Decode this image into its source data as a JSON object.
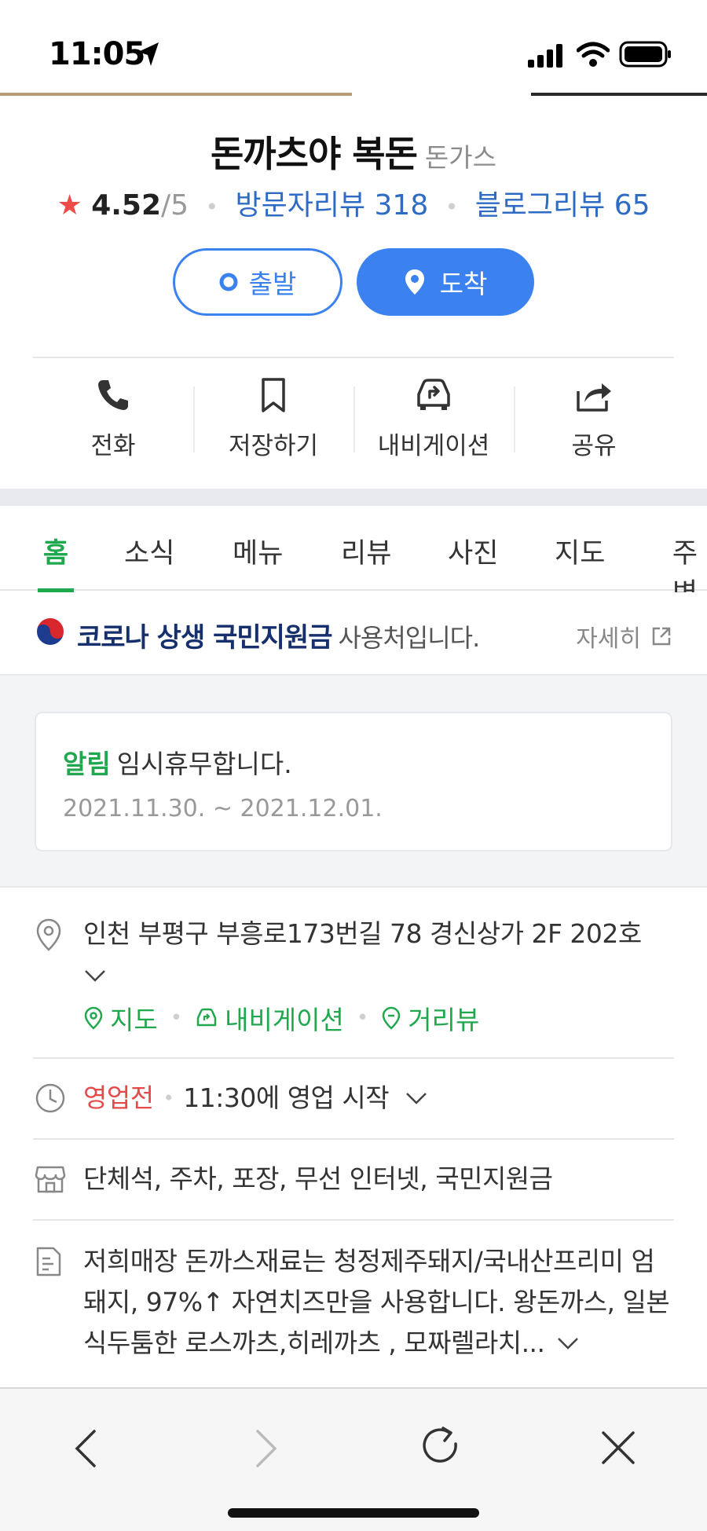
{
  "status_bar": {
    "time": "11:05"
  },
  "place": {
    "name": "돈까츠야 복돈",
    "category": "돈가스",
    "rating": "4.52",
    "rating_max": "/5",
    "visitor_reviews": "방문자리뷰 318",
    "blog_reviews": "블로그리뷰 65"
  },
  "route_buttons": {
    "start": "출발",
    "arrive": "도착"
  },
  "actions": [
    {
      "label": "전화",
      "icon": "phone-icon"
    },
    {
      "label": "저장하기",
      "icon": "bookmark-icon"
    },
    {
      "label": "내비게이션",
      "icon": "car-navigation-icon"
    },
    {
      "label": "공유",
      "icon": "share-icon"
    }
  ],
  "tabs": [
    "홈",
    "소식",
    "메뉴",
    "리뷰",
    "사진",
    "지도",
    "주변"
  ],
  "active_tab": "홈",
  "covid_banner": {
    "highlight": "코로나 상생 국민지원금",
    "suffix": "사용처입니다.",
    "more": "자세히"
  },
  "notice": {
    "tag": "알림",
    "text": "임시휴무합니다.",
    "date": "2021.11.30. ~ 2021.12.01."
  },
  "info": {
    "address": "인천 부평구 부흥로173번길 78 경신상가 2F 202호",
    "address_links": [
      "지도",
      "내비게이션",
      "거리뷰"
    ],
    "status": "영업전",
    "hours": "11:30에 영업 시작",
    "amenities": "단체석, 주차, 포장, 무선 인터넷, 국민지원금",
    "description_lines": [
      "저희매장 돈까스재료는 청정제주돼지/국내산프리미 엄",
      "돼지, 97%↑ 자연치즈만을 사용합니다. 왕돈까스, 일본",
      "식두툼한 로스까츠,히레까츠 , 모짜렐라치..."
    ]
  },
  "colors": {
    "accent_blue": "#3b82f0",
    "naver_green": "#20a84f",
    "closed_red": "#e44a4a",
    "star_red": "#ef4b4b"
  }
}
